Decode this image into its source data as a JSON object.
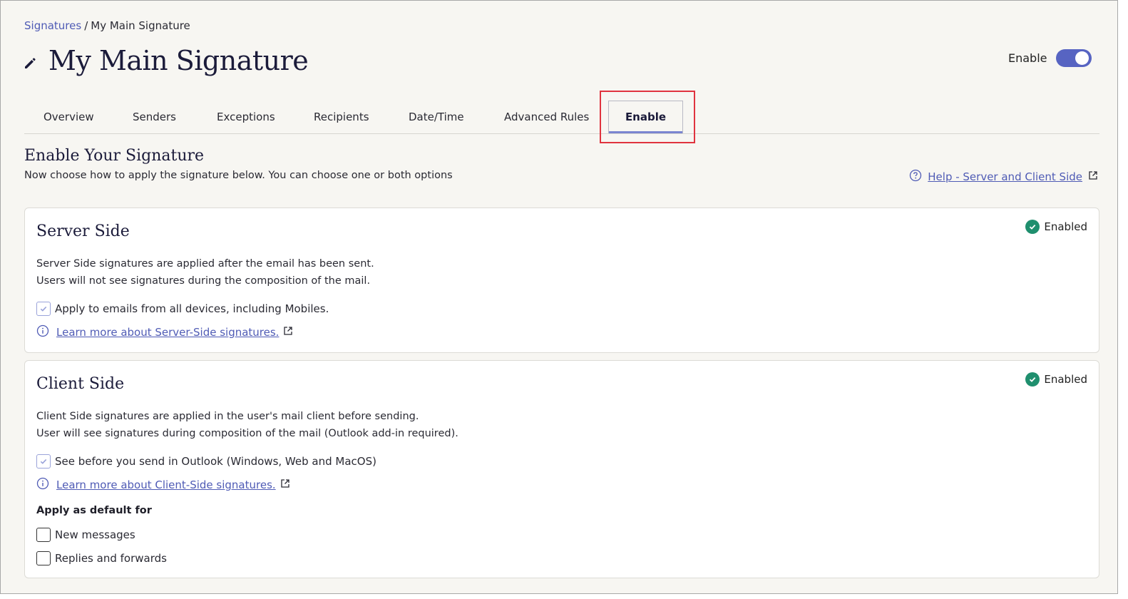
{
  "breadcrumb": {
    "root": "Signatures",
    "separator": "/",
    "current": "My Main Signature"
  },
  "header": {
    "title": "My Main Signature",
    "enable_label": "Enable",
    "enabled": true
  },
  "tabs": [
    {
      "label": "Overview"
    },
    {
      "label": "Senders"
    },
    {
      "label": "Exceptions"
    },
    {
      "label": "Recipients"
    },
    {
      "label": "Date/Time"
    },
    {
      "label": "Advanced Rules"
    },
    {
      "label": "Enable",
      "active": true
    }
  ],
  "section": {
    "title": "Enable Your Signature",
    "subtitle": "Now choose how to apply the signature below. You can choose one or both options",
    "help_link": "Help - Server and Client Side"
  },
  "server_side": {
    "title": "Server Side",
    "status": "Enabled",
    "desc_line1": "Server Side signatures are applied after the email has been sent.",
    "desc_line2": "Users will not see signatures during the composition of the mail.",
    "checkbox_label": "Apply to emails from all devices, including Mobiles.",
    "checkbox_checked": true,
    "learn_more": "Learn more about Server-Side signatures."
  },
  "client_side": {
    "title": "Client Side",
    "status": "Enabled",
    "desc_line1": "Client Side signatures are applied in the user's mail client before sending.",
    "desc_line2": "User will see signatures during composition of the mail (Outlook add-in required).",
    "checkbox_label": "See before you send in Outlook (Windows, Web and MacOS)",
    "checkbox_checked": true,
    "learn_more": "Learn more about Client-Side signatures.",
    "default_heading": "Apply as default for",
    "default_options": [
      {
        "label": "New messages",
        "checked": false
      },
      {
        "label": "Replies and forwards",
        "checked": false
      }
    ]
  },
  "colors": {
    "accent": "#5764c2",
    "link": "#4f5bb5",
    "success": "#1f8f6e",
    "highlight": "#e0333f"
  }
}
